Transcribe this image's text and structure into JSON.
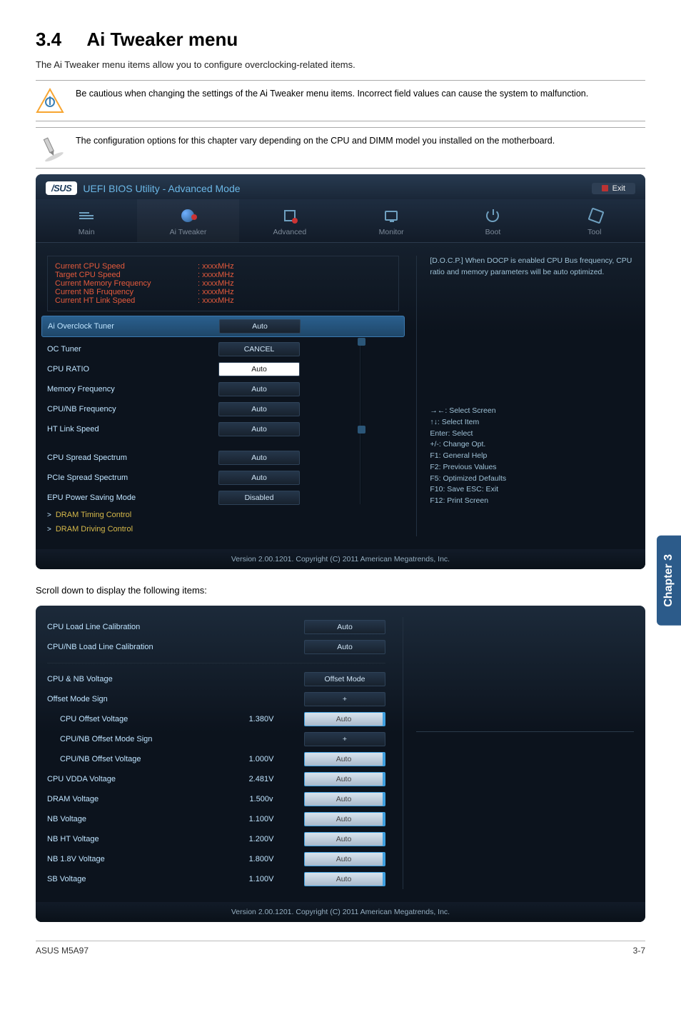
{
  "heading_num": "3.4",
  "heading_text": "Ai Tweaker menu",
  "intro": "The Ai Tweaker menu items allow you to configure overclocking-related items.",
  "note1": "Be cautious when changing the settings of the Ai Tweaker menu items. Incorrect field values can cause the system to malfunction.",
  "note2": "The configuration options for this chapter vary depending on the CPU and DIMM model you installed on the motherboard.",
  "bios": {
    "brand": "/SUS",
    "title": "UEFI BIOS Utility - Advanced Mode",
    "exit": "Exit",
    "tabs": [
      "Main",
      "Ai Tweaker",
      "Advanced",
      "Monitor",
      "Boot",
      "Tool"
    ],
    "info": [
      {
        "label": "Current CPU Speed",
        "value": ": xxxxMHz"
      },
      {
        "label": "Target CPU Speed",
        "value": ": xxxxMHz"
      },
      {
        "label": "Current Memory Frequency",
        "value": ": xxxxMHz"
      },
      {
        "label": "Current NB Fruquency",
        "value": ": xxxxMHz"
      },
      {
        "label": "Current HT Link Speed",
        "value": ": xxxxMHz"
      }
    ],
    "settings": [
      {
        "label": "Ai Overclock Tuner",
        "value": "Auto",
        "highlight": true
      },
      {
        "label": "OC Tuner",
        "value": "CANCEL"
      },
      {
        "label": "CPU RATIO",
        "value": "Auto",
        "white": true
      },
      {
        "label": "Memory Frequency",
        "value": "Auto"
      },
      {
        "label": "CPU/NB Frequency",
        "value": "Auto"
      },
      {
        "label": "HT Link Speed",
        "value": "Auto"
      },
      {
        "label": ""
      },
      {
        "label": "CPU Spread Spectrum",
        "value": "Auto"
      },
      {
        "label": "PCIe Spread Spectrum",
        "value": "Auto"
      },
      {
        "label": "EPU Power Saving Mode",
        "value": "Disabled"
      },
      {
        "label": "DRAM Timing Control",
        "chev": true
      },
      {
        "label": "DRAM Driving Control",
        "chev": true
      }
    ],
    "right_help": "[D.O.C.P.] When DOCP is enabled CPU Bus frequency, CPU ratio and memory parameters will be auto optimized.",
    "keys": [
      "→←: Select Screen",
      "↑↓: Select Item",
      "Enter: Select",
      "+/-: Change Opt.",
      "F1: General Help",
      "F2: Previous Values",
      "F5: Optimized Defaults",
      "F10: Save   ESC: Exit",
      "F12: Print Screen"
    ],
    "footer": "Version 2.00.1201.  Copyright (C) 2011 American Megatrends, Inc."
  },
  "scroll_text": "Scroll down to display the following items:",
  "panel2": {
    "rows_top": [
      {
        "label": "CPU Load Line Calibration",
        "value": "Auto"
      },
      {
        "label": "CPU/NB Load Line Calibration",
        "value": "Auto"
      }
    ],
    "rows": [
      {
        "label": "CPU & NB Voltage",
        "mid": "",
        "value": "Offset Mode"
      },
      {
        "label": "Offset Mode Sign",
        "mid": "",
        "value": "+"
      },
      {
        "label": "CPU Offset Voltage",
        "indent": true,
        "mid": "1.380V",
        "value": "Auto",
        "blue": true
      },
      {
        "label": "CPU/NB Offset Mode Sign",
        "indent": true,
        "mid": "",
        "value": "+"
      },
      {
        "label": "CPU/NB Offset Voltage",
        "indent": true,
        "mid": "1.000V",
        "value": "Auto",
        "blue": true
      },
      {
        "label": "CPU VDDA Voltage",
        "mid": "2.481V",
        "value": "Auto",
        "blue": true
      },
      {
        "label": "DRAM Voltage",
        "mid": "1.500v",
        "value": "Auto",
        "blue": true
      },
      {
        "label": "NB Voltage",
        "mid": "1.100V",
        "value": "Auto",
        "blue": true
      },
      {
        "label": "NB HT Voltage",
        "mid": "1.200V",
        "value": "Auto",
        "blue": true
      },
      {
        "label": "NB 1.8V Voltage",
        "mid": "1.800V",
        "value": "Auto",
        "blue": true
      },
      {
        "label": "SB Voltage",
        "mid": "1.100V",
        "value": "Auto",
        "blue": true
      }
    ]
  },
  "side_tab": "Chapter 3",
  "footer_left": "ASUS M5A97",
  "footer_right": "3-7"
}
